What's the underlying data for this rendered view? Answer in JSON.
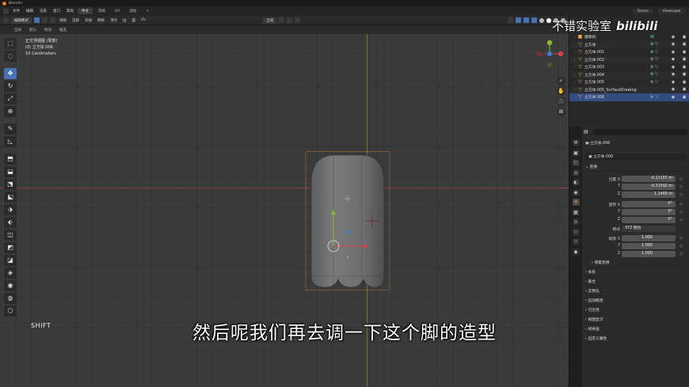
{
  "window": {
    "title": "Blender"
  },
  "menubar": {
    "items": [
      "文件",
      "编辑",
      "渲染",
      "窗口",
      "帮助"
    ],
    "workspaces": [
      {
        "label": "中文",
        "active": true
      },
      {
        "label": "常规",
        "active": false
      },
      {
        "label": "UV",
        "active": false
      },
      {
        "label": "添加",
        "active": false
      },
      {
        "label": "+",
        "active": false
      }
    ],
    "scene": "Scene",
    "view_layer": "ViewLayer"
  },
  "header": {
    "mode": "编辑模式",
    "menus": [
      "视图",
      "选择",
      "添加",
      "网格",
      "顶点",
      "边",
      "面",
      "UV"
    ],
    "transform_orientation": "全局"
  },
  "subheader": {
    "orientation_label": "全局",
    "default_label": "默认",
    "drag_label": "拖动",
    "select_label": "框选"
  },
  "viewport": {
    "info_lines": [
      "正交顶视图 (局部)",
      "(0) 立方体.006",
      "10 Centimeters"
    ],
    "modifier_text": "SHIFT",
    "tools": [
      "⬚",
      "◌",
      "✥",
      "↻",
      "⤢",
      "⊕",
      "✎",
      "◺",
      "⬒",
      "⬓",
      "⬔",
      "⬕",
      "⬗",
      "⬖",
      "◫",
      "◩",
      "◪",
      "◈",
      "◉",
      "◍",
      "⬡",
      "◇",
      "▰",
      "⬚"
    ],
    "nav_icons": [
      "⌕",
      "✋",
      "🎥",
      "⊞"
    ],
    "colors": {
      "x_axis": "#d9414b",
      "y_axis": "#8ab830",
      "z_axis": "#3d7fd9",
      "active_tool": "#4772b3"
    }
  },
  "subtitle": "然后呢我们再去调一下这个脚的造型",
  "watermark": {
    "text": "不错实验室",
    "brand": "bilibili"
  },
  "outliner": {
    "rows": [
      {
        "name": "摄像机",
        "mods": "⌘",
        "selected": false,
        "type": "camera"
      },
      {
        "name": "立方体",
        "mods": "⚙ ▽",
        "selected": false,
        "type": "mesh"
      },
      {
        "name": "立方体.001",
        "mods": "⚙ ▽",
        "selected": false,
        "type": "mesh"
      },
      {
        "name": "立方体.002",
        "mods": "⚙ ▽",
        "selected": false,
        "type": "mesh"
      },
      {
        "name": "立方体.003",
        "mods": "⚙ ▽",
        "selected": false,
        "type": "mesh"
      },
      {
        "name": "立方体.004",
        "mods": "⚙ ▽",
        "selected": false,
        "type": "mesh"
      },
      {
        "name": "立方体.005",
        "mods": "⚙ ▽",
        "selected": false,
        "type": "mesh"
      },
      {
        "name": "立方体.005_SurfaceDrawing",
        "mods": "",
        "selected": false,
        "type": "mesh"
      },
      {
        "name": "立方体.006",
        "mods": "⚙ ▽",
        "selected": true,
        "type": "mesh"
      }
    ]
  },
  "properties": {
    "search_placeholder": "",
    "object_name": "立方体.006",
    "data_name": "立方体.006",
    "transform_header": "变换",
    "location_label": "位置 X",
    "location": [
      "-0.11107 m",
      "-0.31592 m",
      "1.1489 m"
    ],
    "rotation_label": "旋转 X",
    "rotation": [
      "0°",
      "0°",
      "0°"
    ],
    "mode_label": "模式",
    "mode_value": "XYZ 欧拉",
    "scale_label": "缩放 X",
    "scale": [
      "1.000",
      "1.000",
      "1.000"
    ],
    "axis_y": "Y",
    "axis_z": "Z",
    "sub_panel": "增量变换",
    "panels": [
      "关系",
      "集合",
      "实例化",
      "运动路径",
      "可见性",
      "视图显示",
      "线条画",
      "自定义属性"
    ],
    "tabs": [
      "⚒",
      "▣",
      "◰",
      "◎",
      "◐",
      "◉",
      "✣",
      "▦",
      "⊙",
      "⬡",
      "▽",
      "◆"
    ]
  }
}
